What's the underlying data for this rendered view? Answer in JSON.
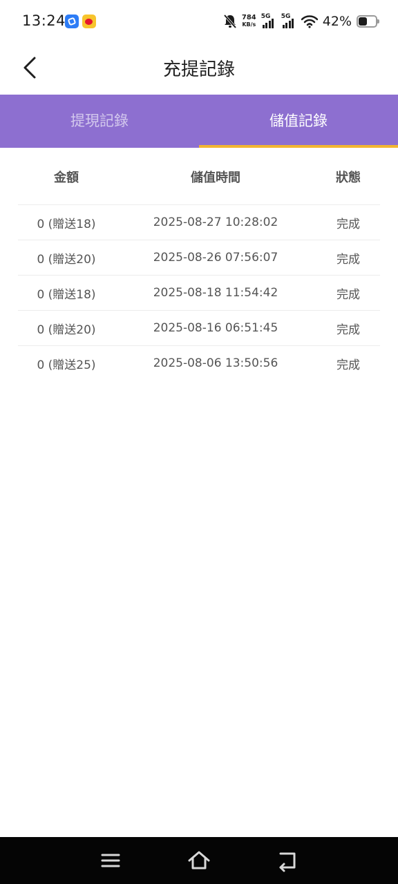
{
  "status_bar": {
    "time": "13:24",
    "net_speed_value": "784",
    "net_speed_unit": "KB/s",
    "signal_1": "5G",
    "signal_2": "5G",
    "battery_percent": "42%",
    "icons": [
      "app-icon",
      "weibo-icon",
      "mute-bell-icon",
      "signal-icon",
      "signal-icon",
      "wifi-icon",
      "battery-icon"
    ]
  },
  "header": {
    "title": "充提記錄",
    "back_icon": "chevron-left-icon"
  },
  "tabs": [
    {
      "label": "提現記錄",
      "active": false
    },
    {
      "label": "儲值記錄",
      "active": true
    }
  ],
  "table": {
    "headers": {
      "amount": "金額",
      "time": "儲值時間",
      "status": "狀態"
    },
    "rows": [
      {
        "amount": "0 (贈送18)",
        "time": "2025-08-27 10:28:02",
        "status": "完成"
      },
      {
        "amount": "0 (贈送20)",
        "time": "2025-08-26 07:56:07",
        "status": "完成"
      },
      {
        "amount": "0 (贈送18)",
        "time": "2025-08-18 11:54:42",
        "status": "完成"
      },
      {
        "amount": "0 (贈送20)",
        "time": "2025-08-16 06:51:45",
        "status": "完成"
      },
      {
        "amount": "0 (贈送25)",
        "time": "2025-08-06 13:50:56",
        "status": "完成"
      }
    ]
  },
  "colors": {
    "tab_bar": "#8d6fd0",
    "tab_indicator": "#f2b531",
    "nav_bar": "#050505"
  },
  "nav_bar": {
    "icons": [
      "menu-icon",
      "home-icon",
      "back-icon"
    ]
  }
}
